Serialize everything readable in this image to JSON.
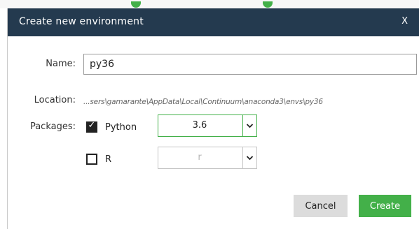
{
  "dialog": {
    "title": "Create new environment",
    "close_label": "X"
  },
  "form": {
    "name_label": "Name:",
    "name_value": "py36",
    "location_label": "Location:",
    "location_value": "...sers\\gamarante\\AppData\\Local\\Continuum\\anaconda3\\envs\\py36",
    "packages_label": "Packages:"
  },
  "packages": [
    {
      "label": "Python",
      "checked": true,
      "version": "3.6",
      "enabled": true
    },
    {
      "label": "R",
      "checked": false,
      "version": "r",
      "enabled": false
    }
  ],
  "buttons": {
    "cancel_label": "Cancel",
    "create_label": "Create"
  },
  "colors": {
    "titlebar": "#243a4f",
    "accent": "#43b049",
    "cancel_bg": "#dcdcdc"
  },
  "icons": {
    "close": "close-icon",
    "checkbox_checked": "check-icon",
    "dropdown": "chevron-down-icon"
  }
}
